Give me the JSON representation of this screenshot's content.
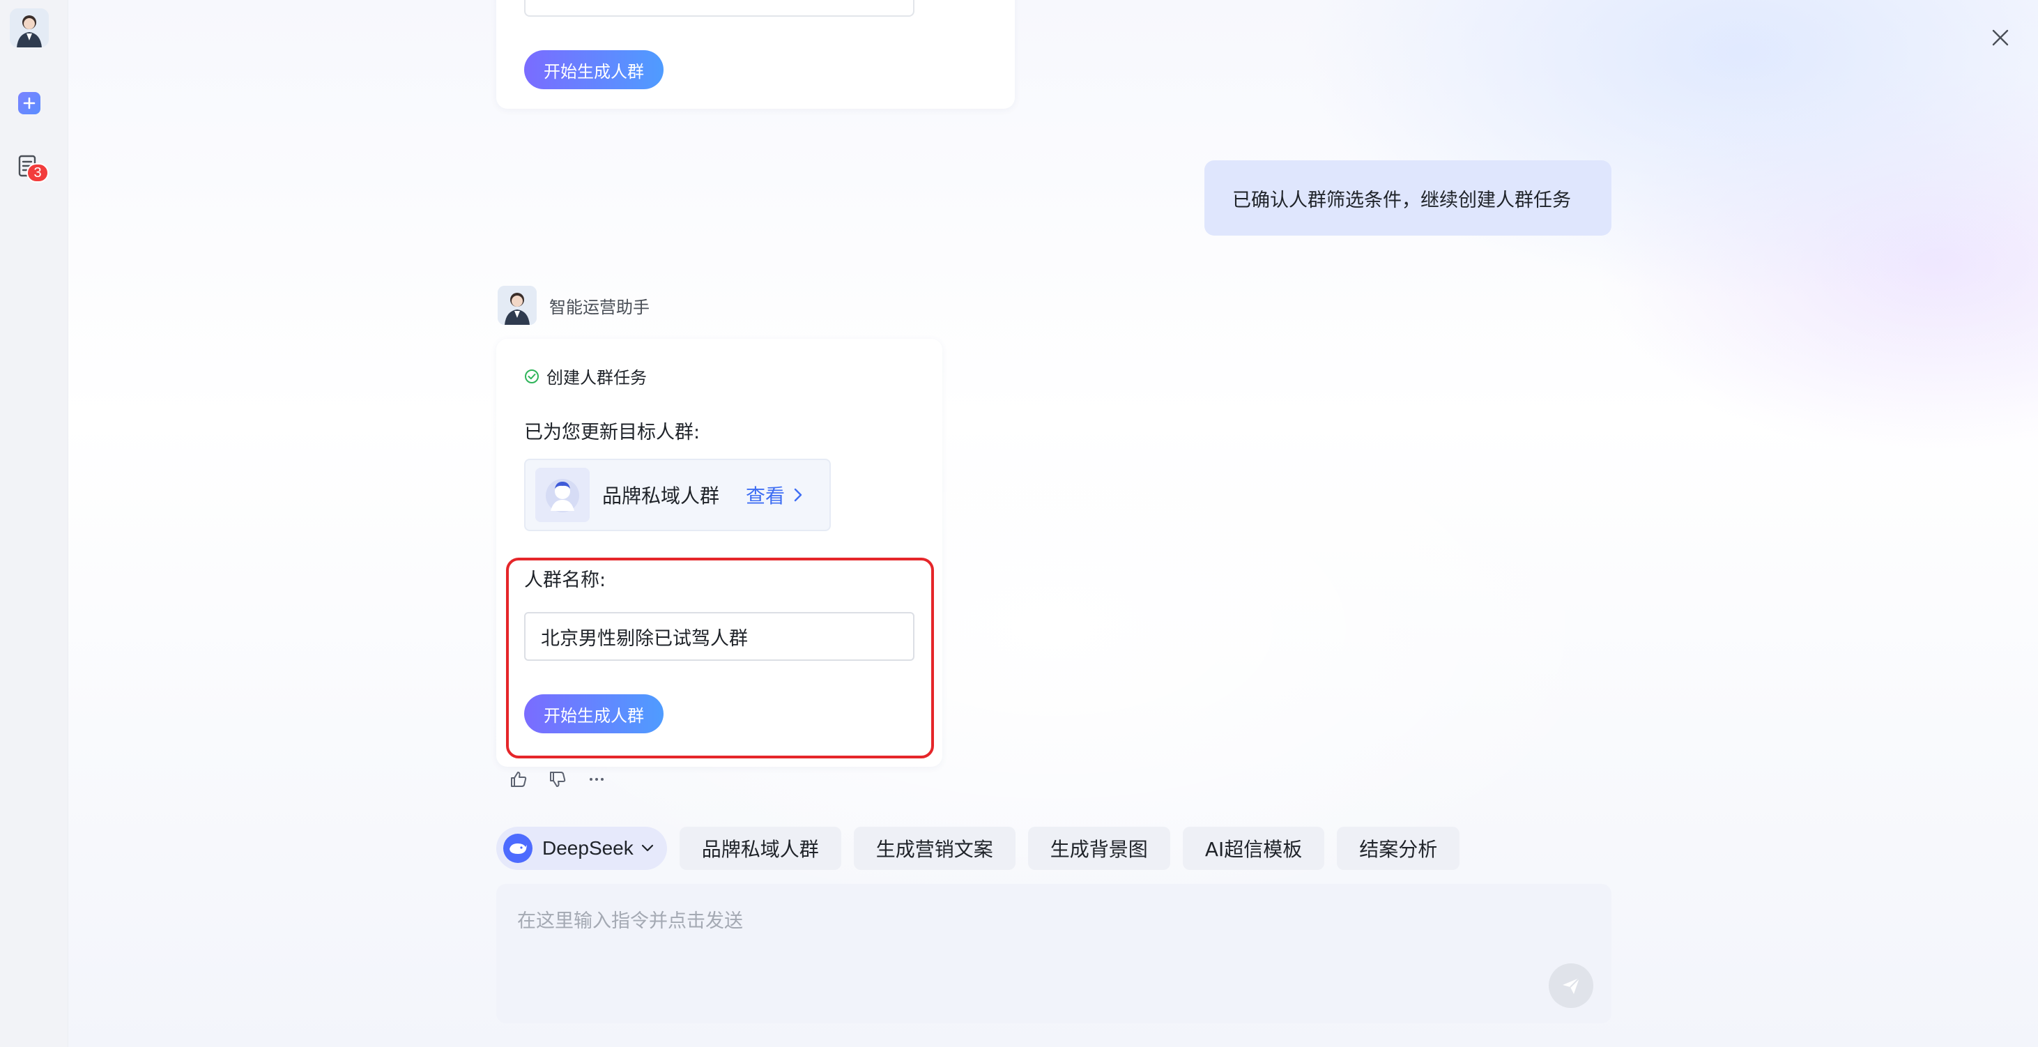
{
  "sidebar": {
    "avatar_icon": "assistant-avatar-icon",
    "new_chat_icon": "plus-icon",
    "tasks_icon": "document-icon",
    "tasks_badge": "3"
  },
  "previous_card": {
    "button_label": "开始生成人群"
  },
  "user_message": "已确认人群筛选条件，继续创建人群任务",
  "assistant": {
    "name": "智能运营助手"
  },
  "reply": {
    "step_text": "创建人群任务",
    "updated_label": "已为您更新目标人群:",
    "audience_name": "品牌私域人群",
    "view_label": "查看",
    "name_label": "人群名称:",
    "name_value": "北京男性剔除已试驾人群",
    "button_label": "开始生成人群"
  },
  "quick_actions": {
    "model": "DeepSeek",
    "items": [
      "品牌私域人群",
      "生成营销文案",
      "生成背景图",
      "AI超信模板",
      "结案分析"
    ]
  },
  "composer": {
    "placeholder": "在这里输入指令并点击发送"
  },
  "colors": {
    "accent": "#3f6ef3",
    "highlight": "#e5262a",
    "user_bubble": "#dfe6fd"
  }
}
